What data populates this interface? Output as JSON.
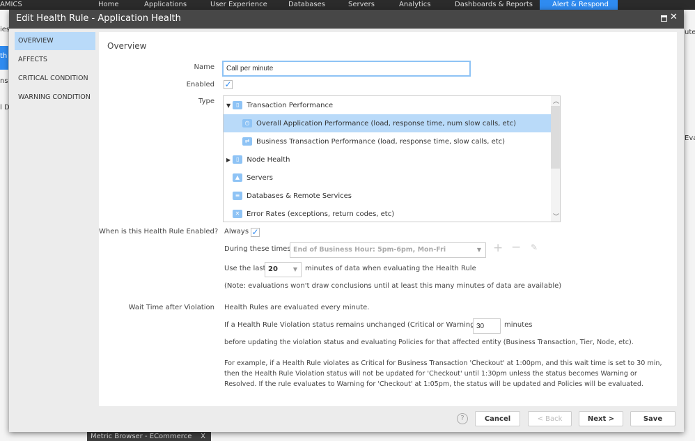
{
  "topnav": [
    "Home",
    "Applications",
    "User Experience",
    "Databases",
    "Servers",
    "Analytics",
    "Dashboards & Reports",
    "Alert & Respond"
  ],
  "background": {
    "logo_fragment": "AMICS",
    "left": [
      "ies",
      "th",
      "ns",
      "l D"
    ],
    "right": [
      "utes",
      "Evalu"
    ],
    "tab": "Metric Browser - ECommerce",
    "tab_close": "X"
  },
  "dialog": {
    "title": "Edit Health Rule - Application Health",
    "sidebar": [
      {
        "label": "OVERVIEW",
        "selected": true
      },
      {
        "label": "AFFECTS"
      },
      {
        "label": "CRITICAL CONDITION"
      },
      {
        "label": "WARNING CONDITION"
      }
    ],
    "section_title": "Overview",
    "name_label": "Name",
    "name_value": "Call per minute",
    "enabled_label": "Enabled",
    "enabled": true,
    "type_label": "Type",
    "types": [
      {
        "label": "Transaction Performance",
        "icon": "folder-icon",
        "expander": "▼",
        "level": 0
      },
      {
        "label": "Overall Application Performance (load, response time, num slow calls, etc)",
        "icon": "stopwatch-icon",
        "level": 1,
        "selected": true
      },
      {
        "label": "Business Transaction Performance (load, response time, slow calls, etc)",
        "icon": "transfer-icon",
        "level": 1
      },
      {
        "label": "Node Health",
        "icon": "folder-icon",
        "expander": "▶",
        "level": 0
      },
      {
        "label": "Servers",
        "icon": "server-icon",
        "level": 0
      },
      {
        "label": "Databases & Remote Services",
        "icon": "database-icon",
        "level": 0
      },
      {
        "label": "Error Rates (exceptions, return codes, etc)",
        "icon": "error-icon",
        "level": 0
      }
    ],
    "when_label": "When is this Health Rule Enabled?",
    "always_label": "Always",
    "always": true,
    "during_label": "During these times:",
    "during_value": "End of Business Hour: 5pm-6pm, Mon-Fri",
    "use_last_label": "Use the last",
    "use_last_value": "20",
    "use_last_suffix": "minutes of data when evaluating the Health Rule",
    "note": "(Note: evaluations won't draw conclusions until at least this many minutes of data are available)",
    "wait_label": "Wait Time after Violation",
    "wait_line1": "Health Rules are evaluated every minute.",
    "wait_line2_pre": "If a Health Rule Violation status remains unchanged (Critical or Warning), wait",
    "wait_value": "30",
    "wait_line2_post": "minutes",
    "wait_line3": "before updating the violation status and evaluating Policies for that affected entity (Business Transaction, Tier, Node, etc).",
    "example": "For example, if a Health Rule violates as Critical for Business Transaction 'Checkout' at 1:00pm, and this wait time is set to 30 min, then the Health Rule Violation status will not be updated for 'Checkout' until 1:30pm unless the status becomes Warning or Resolved. If the rule evaluates to Warning for 'Checkout' at 1:05pm, the status will be updated and Policies will be evaluated.",
    "buttons": {
      "help": "?",
      "cancel": "Cancel",
      "back": "< Back",
      "next": "Next >",
      "save": "Save"
    }
  },
  "colors": {
    "accent": "#2f8bf0",
    "selected": "#b9daf9",
    "titlebar": "#474747"
  }
}
